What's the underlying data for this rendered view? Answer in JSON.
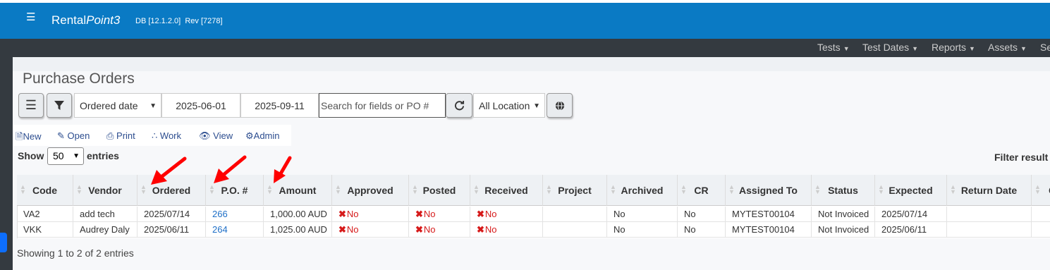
{
  "app": {
    "brand_prefix": "Rental",
    "brand_suffix": "Point3",
    "db_version": "DB [12.1.2.0]",
    "rev": "Rev [7278]"
  },
  "menu": [
    {
      "label": "Tests"
    },
    {
      "label": "Test Dates"
    },
    {
      "label": "Reports"
    },
    {
      "label": "Assets"
    },
    {
      "label": "Se"
    }
  ],
  "page": {
    "title": "Purchase Orders"
  },
  "filters": {
    "date_field": "Ordered date",
    "date_from": "2025-06-01",
    "date_to": "2025-09-11",
    "search_placeholder": "Search for fields or PO #",
    "location": "All Location"
  },
  "actions": [
    {
      "label": "New",
      "icon": "file-icon"
    },
    {
      "label": "Open",
      "icon": "edit-icon"
    },
    {
      "label": "Print",
      "icon": "print-icon"
    },
    {
      "label": "Work",
      "icon": "spinner-icon"
    },
    {
      "label": "View",
      "icon": "eye-icon"
    },
    {
      "label": "Admin",
      "icon": "cogs-icon"
    }
  ],
  "table": {
    "show_label": "Show",
    "entries_value": "50",
    "entries_label": "entries",
    "filter_label": "Filter result",
    "columns": [
      "Code",
      "Vendor",
      "Ordered",
      "P.O. #",
      "Amount",
      "Approved",
      "Posted",
      "Received",
      "Project",
      "Archived",
      "CR",
      "Assigned To",
      "Status",
      "Expected",
      "Return Date",
      "C"
    ],
    "rows": [
      [
        "VA2",
        "add tech",
        "2025/07/14",
        "266",
        "1,000.00 AUD",
        "No",
        "No",
        "No",
        "",
        "No",
        "No",
        "MYTEST00104",
        "Not Invoiced",
        "2025/07/14",
        "",
        ""
      ],
      [
        "VKK",
        "Audrey Daly",
        "2025/06/11",
        "264",
        "1,025.00 AUD",
        "No",
        "No",
        "No",
        "",
        "No",
        "No",
        "MYTEST00104",
        "Not Invoiced",
        "2025/06/11",
        "",
        ""
      ]
    ],
    "info": "Showing 1 to 2 of 2 entries"
  },
  "colors": {
    "accent": "#0a7ac4",
    "dark_nav": "#343a40",
    "link": "#1e6fc7",
    "negative": "#d61a1a",
    "annotation_arrow": "#ff0000"
  }
}
